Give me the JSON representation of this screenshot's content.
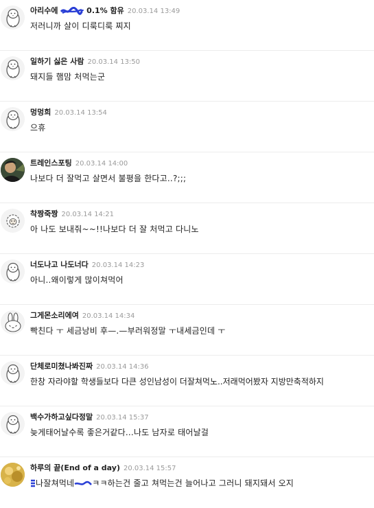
{
  "comments": [
    {
      "nick_a": "아리수에",
      "nick_b": "0.1% 함유",
      "time": "20.03.14 13:49",
      "text": "저러니까 살이 디룩디룩 찌지",
      "avatar": "penguin-icon"
    },
    {
      "nick": "일하기 싫은 사람",
      "time": "20.03.14 13:50",
      "text": "돼지들 햄맘 처먹는군",
      "avatar": "penguin-icon"
    },
    {
      "nick": "멍멍희",
      "time": "20.03.14 13:54",
      "text": "으휴",
      "avatar": "penguin-icon"
    },
    {
      "nick": "트레인스포팅",
      "time": "20.03.14 14:00",
      "text": "나보다 더 잘먹고 살면서 불평을 한다고..?;;;",
      "avatar": "photo-avatar"
    },
    {
      "nick": "착짱죽짱",
      "time": "20.03.14 14:21",
      "text": "아 나도 보내줘~~!!나보다 더 잘 처먹고 다니노",
      "avatar": "sheep-icon"
    },
    {
      "nick": "너도나고 나도너다",
      "time": "20.03.14 14:23",
      "text": "아니..왜이렇게 많이쳐먹어",
      "avatar": "penguin-icon"
    },
    {
      "nick": "그게몬소리에여",
      "time": "20.03.14 14:34",
      "text": "빡친다 ㅜ 세금낭비 후—.—부러워정말 ㅜ내세금인데 ㅜ",
      "avatar": "rabbit-icon"
    },
    {
      "nick": "단체로미쳤나봐진짜",
      "time": "20.03.14 14:36",
      "text": "한창 자라야할 학생들보다 다큰 성인남성이 더잘쳐먹노..저래먹어봤자 지방만축적하지",
      "avatar": "penguin-icon"
    },
    {
      "nick": "백수가하고싶다정말",
      "time": "20.03.14 15:37",
      "text": "늦게태어날수록 좋은거같다...나도 남자로 태어날걸",
      "avatar": "penguin-icon"
    },
    {
      "nick": "하루의 끝(End of a day)",
      "time": "20.03.14 15:57",
      "text_a": "나잘쳐먹네",
      "text_b": "ㅋㅋ하는건 줄고 쳐먹는건 늘어나고 그러니 돼지돼서 오지",
      "avatar": "gold-photo-avatar"
    }
  ],
  "colors": {
    "scribble": "#2a3fd6",
    "divider": "#ececec",
    "time": "#9a9a9a"
  }
}
